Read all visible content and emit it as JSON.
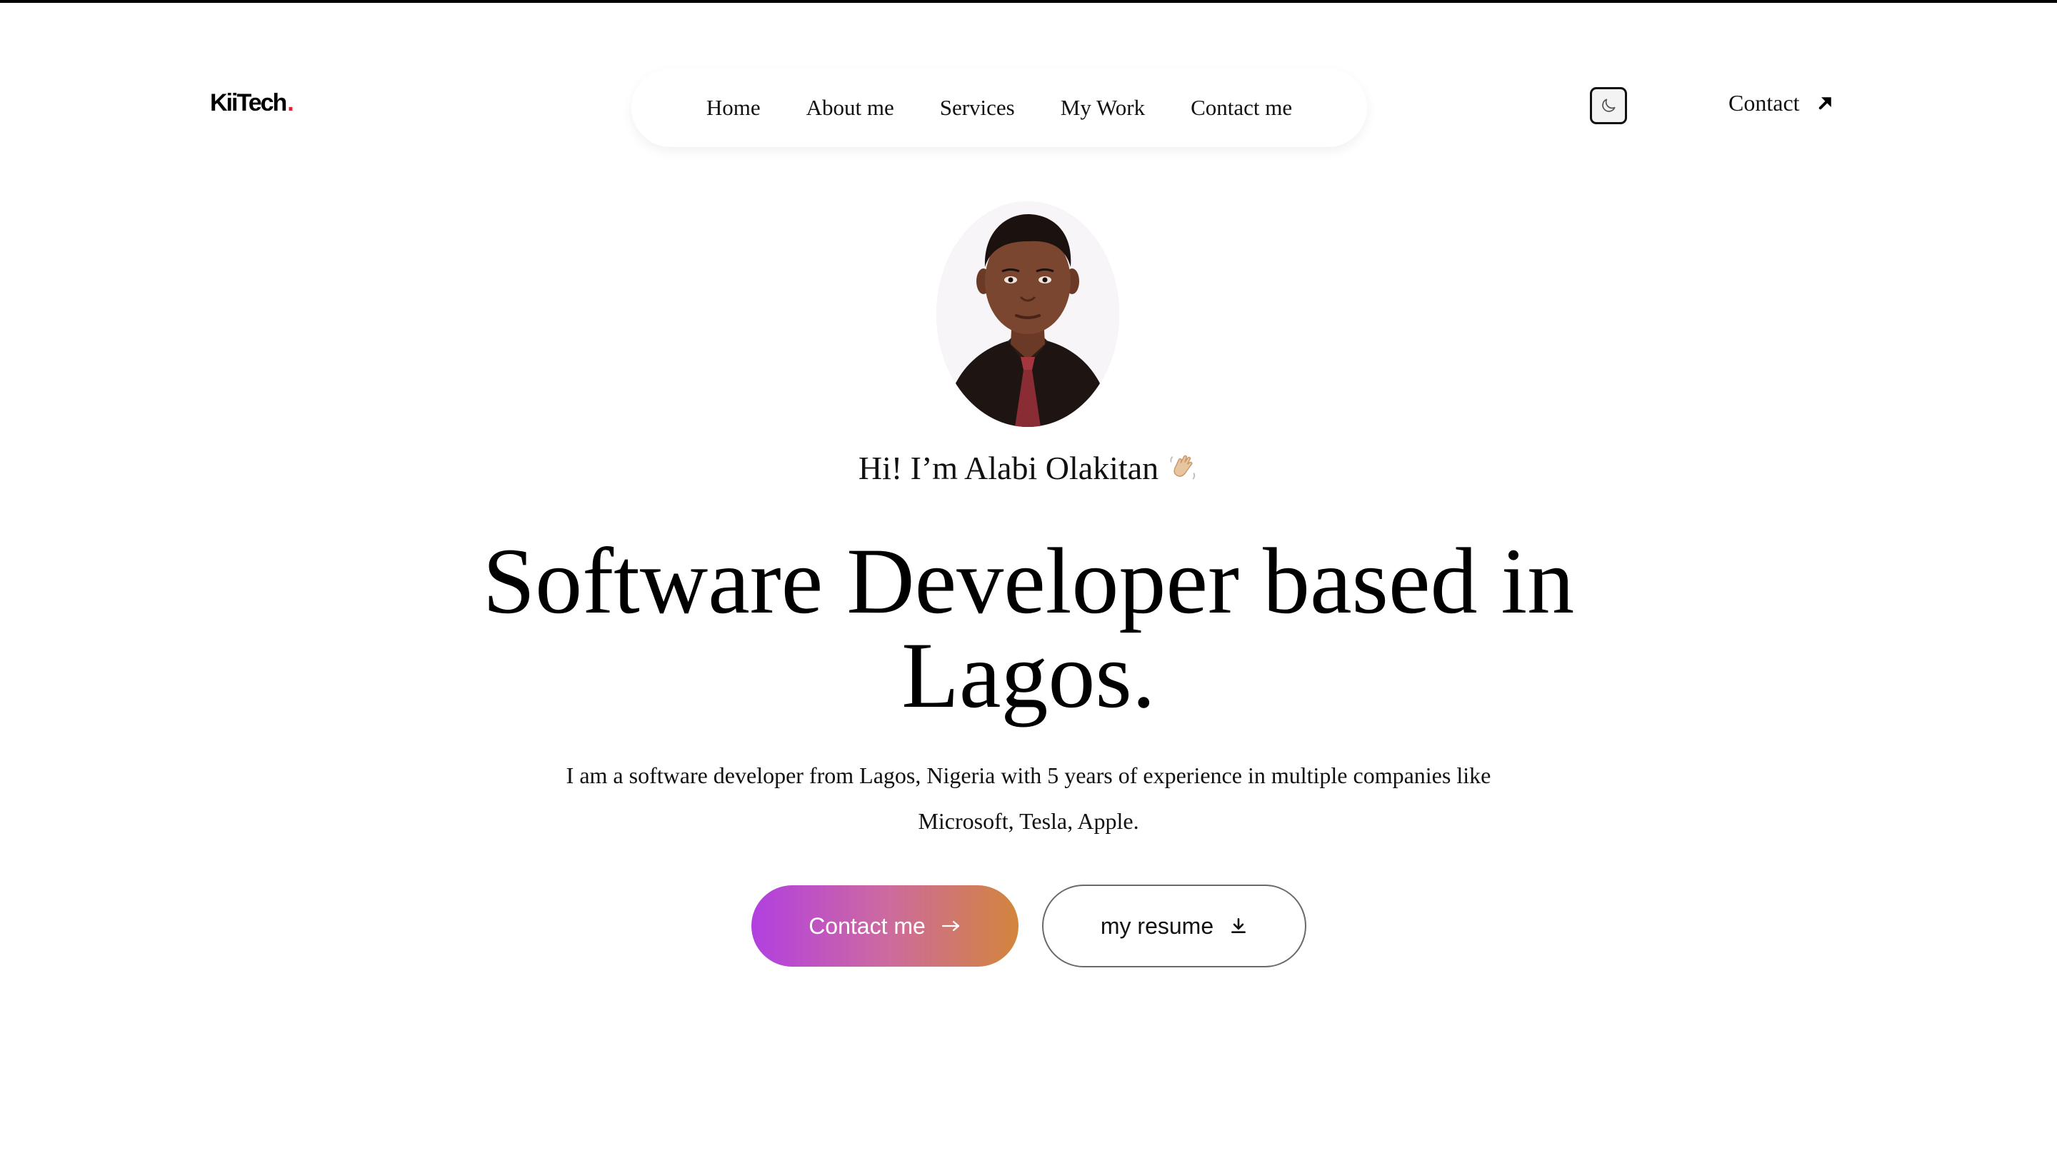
{
  "header": {
    "logo_text": "KiiTech",
    "logo_dot": ".",
    "nav": [
      {
        "label": "Home"
      },
      {
        "label": "About me"
      },
      {
        "label": "Services"
      },
      {
        "label": "My Work"
      },
      {
        "label": "Contact me"
      }
    ],
    "theme_toggle_icon": "moon-icon",
    "contact_label": "Contact",
    "contact_icon": "arrow-up-right-icon"
  },
  "hero": {
    "avatar_icon": "profile-photo",
    "greeting": "Hi! I’m Alabi Olakitan",
    "greeting_icon": "waving-hand-icon",
    "headline": "Software Developer based in Lagos.",
    "description": "I am a software developer from Lagos, Nigeria with 5 years of experience in multiple companies like Microsoft, Tesla, Apple.",
    "primary_button": {
      "label": "Contact me",
      "icon": "arrow-right-icon"
    },
    "secondary_button": {
      "label": "my resume",
      "icon": "download-icon"
    }
  },
  "colors": {
    "logo_dot": "#e0213c",
    "gradient_start": "#b23fe0",
    "gradient_end": "#d3853c"
  }
}
